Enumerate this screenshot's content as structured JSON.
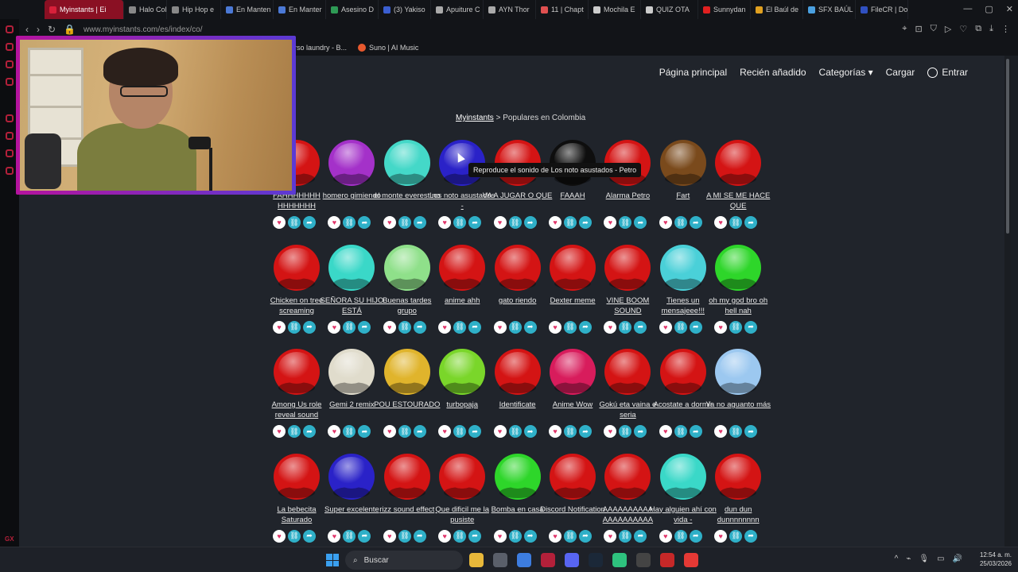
{
  "browser": {
    "tabs": [
      {
        "label": "Myinstants | Ei",
        "color": "#d8203a",
        "active": true
      },
      {
        "label": "Halo Colle",
        "color": "#888888"
      },
      {
        "label": "Hip Hop e",
        "color": "#888888"
      },
      {
        "label": "En Manten",
        "color": "#4b79d6"
      },
      {
        "label": "En Manter",
        "color": "#4b79d6"
      },
      {
        "label": "Asesino D",
        "color": "#2e9a55"
      },
      {
        "label": "(3) Yakiso",
        "color": "#3b5fd1"
      },
      {
        "label": "Apuiture C",
        "color": "#aaaaaa"
      },
      {
        "label": "AYN Thor",
        "color": "#aaaaaa"
      },
      {
        "label": "11 | Chapt",
        "color": "#e05050"
      },
      {
        "label": "Mochila E",
        "color": "#cccccc"
      },
      {
        "label": "QUIZ OTA",
        "color": "#cccccc"
      },
      {
        "label": "Sunnydan",
        "color": "#e02020"
      },
      {
        "label": "El Baúl de",
        "color": "#e0a020"
      },
      {
        "label": "SFX BAÚL",
        "color": "#4aa0e0"
      },
      {
        "label": "FileCR | Do",
        "color": "#3050c0"
      }
    ],
    "url": "www.myinstants.com/es/index/co/",
    "bookmarks": [
      {
        "label": "rso laundry - B..."
      },
      {
        "label": "Suno | AI Music"
      }
    ]
  },
  "site": {
    "nav": {
      "home": "Página principal",
      "recent": "Recién añadido",
      "categories": "Categorías",
      "upload": "Cargar",
      "login": "Entrar"
    },
    "breadcrumb_root": "Myinstants",
    "breadcrumb_current": "> Populares en Colombia",
    "tooltip": "Reproduce el sonido de Los noto asustados - Petro"
  },
  "sounds": [
    {
      "label": "FAHHHHHHH HHHHHHH",
      "color": "#d41414"
    },
    {
      "label": "homero gimiendo",
      "color": "#a431c9"
    },
    {
      "label": "el monte everest no",
      "color": "#44d8c8"
    },
    {
      "label": "Los noto asustados -",
      "color": "#2a22c8"
    },
    {
      "label": "VA A JUGAR O QUE",
      "color": "#d41414"
    },
    {
      "label": "FAAAH",
      "color": "#0e0e0e"
    },
    {
      "label": "Alarma Petro",
      "color": "#d41414"
    },
    {
      "label": "Fart",
      "color": "#7a4a1c"
    },
    {
      "label": "A MI SE ME HACE QUE",
      "color": "#d41414"
    },
    {
      "label": "Chicken on tree screaming",
      "color": "#d41414"
    },
    {
      "label": "SEÑORA SU HIJO ESTÁ",
      "color": "#3ad8c8"
    },
    {
      "label": "Buenas tardes grupo",
      "color": "#8fe08a"
    },
    {
      "label": "anime ahh",
      "color": "#d41414"
    },
    {
      "label": "gato riendo",
      "color": "#d41414"
    },
    {
      "label": "Dexter meme",
      "color": "#d41414"
    },
    {
      "label": "VINE BOOM SOUND",
      "color": "#d41414"
    },
    {
      "label": "Tienes un mensajeee!!!",
      "color": "#4ad0d8"
    },
    {
      "label": "oh my god bro oh hell nah",
      "color": "#2ed62a"
    },
    {
      "label": "Among Us role reveal sound",
      "color": "#d41414"
    },
    {
      "label": "Gemi 2 remix",
      "color": "#e0dccc"
    },
    {
      "label": "POU ESTOURADO",
      "color": "#e0b42c"
    },
    {
      "label": "turbopaja",
      "color": "#7ad62a"
    },
    {
      "label": "Identificate",
      "color": "#d41414"
    },
    {
      "label": "Anime Wow",
      "color": "#d81c5c"
    },
    {
      "label": "Gokú eta vaina e seria",
      "color": "#d41414"
    },
    {
      "label": "Acostate a dormir",
      "color": "#d41414"
    },
    {
      "label": "Ya no aguanto más",
      "color": "#9cc8f0"
    },
    {
      "label": "La bebecita Saturado",
      "color": "#d41414"
    },
    {
      "label": "Super excelente",
      "color": "#2a22c8"
    },
    {
      "label": "rizz sound effect",
      "color": "#d41414"
    },
    {
      "label": "Que dificil me la pusiste",
      "color": "#d41414"
    },
    {
      "label": "Bomba en casa",
      "color": "#2ed62a"
    },
    {
      "label": "Discord Notification",
      "color": "#d41414"
    },
    {
      "label": "AAAAAAAAAA AAAAAAAAAA",
      "color": "#d41414"
    },
    {
      "label": "Hay alguien ahí con vida -",
      "color": "#3ad8c8"
    },
    {
      "label": "dun dun dunnnnnnnn",
      "color": "#d41414"
    }
  ],
  "taskbar": {
    "search_placeholder": "Buscar",
    "time": "12:54 a. m.",
    "date": "25/03/2026"
  },
  "colors": {
    "accent": "#b3203a",
    "page_bg": "#20242b",
    "action_teal": "#2fb0c8",
    "heart_pink": "#e0356a"
  }
}
